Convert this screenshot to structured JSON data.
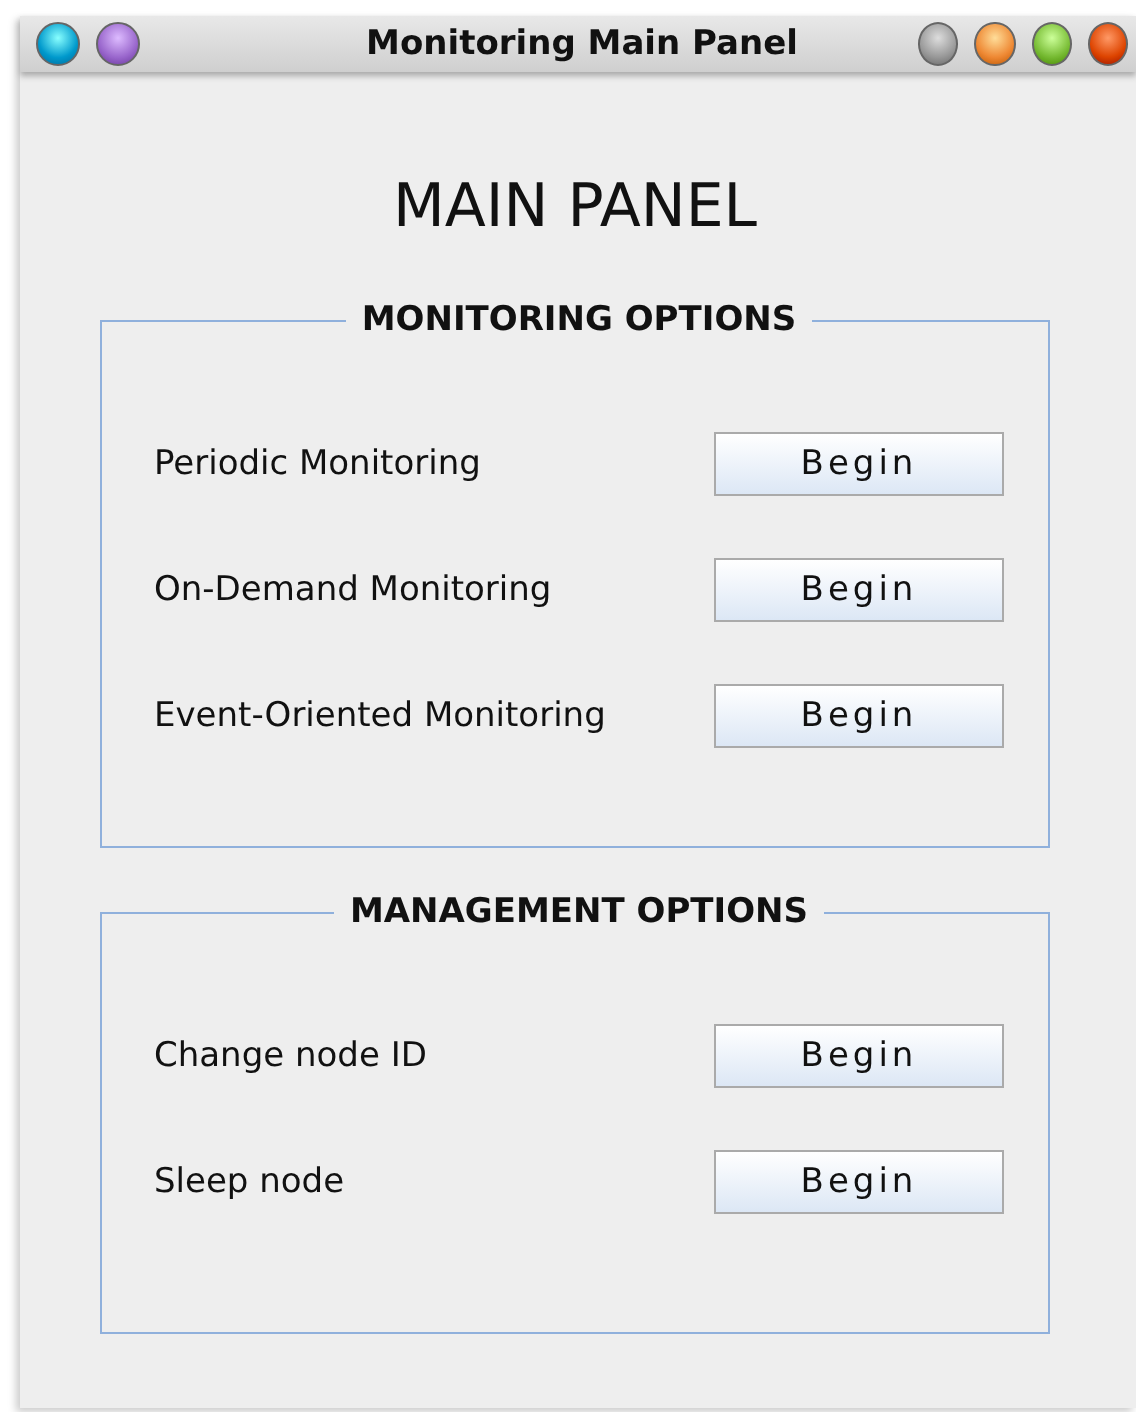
{
  "window": {
    "title": "Monitoring Main Panel"
  },
  "heading": "MAIN PANEL",
  "groups": [
    {
      "title": "MONITORING OPTIONS",
      "rows": [
        {
          "label": "Periodic Monitoring",
          "button": "Begin"
        },
        {
          "label": "On-Demand Monitoring",
          "button": "Begin"
        },
        {
          "label": "Event-Oriented Monitoring",
          "button": "Begin"
        }
      ]
    },
    {
      "title": "MANAGEMENT OPTIONS",
      "rows": [
        {
          "label": "Change node ID",
          "button": "Begin"
        },
        {
          "label": "Sleep node",
          "button": "Begin"
        }
      ]
    }
  ]
}
